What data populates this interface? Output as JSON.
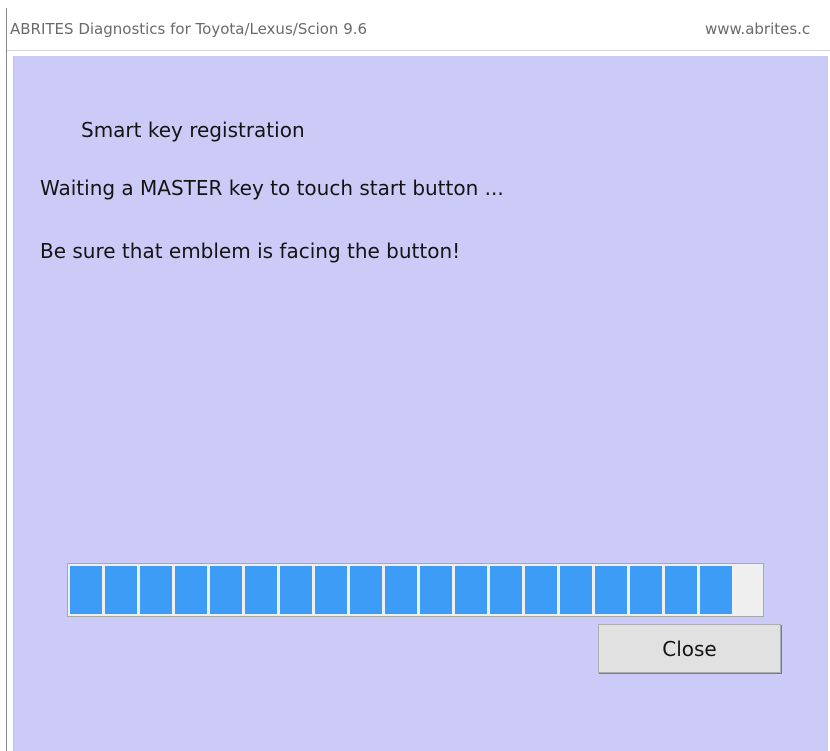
{
  "window": {
    "title": "ABRITES Diagnostics for Toyota/Lexus/Scion 9.6",
    "url_text": "www.abrites.c"
  },
  "dialog": {
    "heading": "Smart key registration",
    "message_1": "Waiting a MASTER key to touch start button ...",
    "message_2": "Be sure that emblem is facing the button!",
    "progress": {
      "filled_segments": 19,
      "percent": 94
    },
    "close_label": "Close"
  },
  "colors": {
    "panel_background": "#cccbf7",
    "progress_fill": "#3c9cf6",
    "progress_track": "#efefef",
    "button_background": "#e1e1e1"
  }
}
